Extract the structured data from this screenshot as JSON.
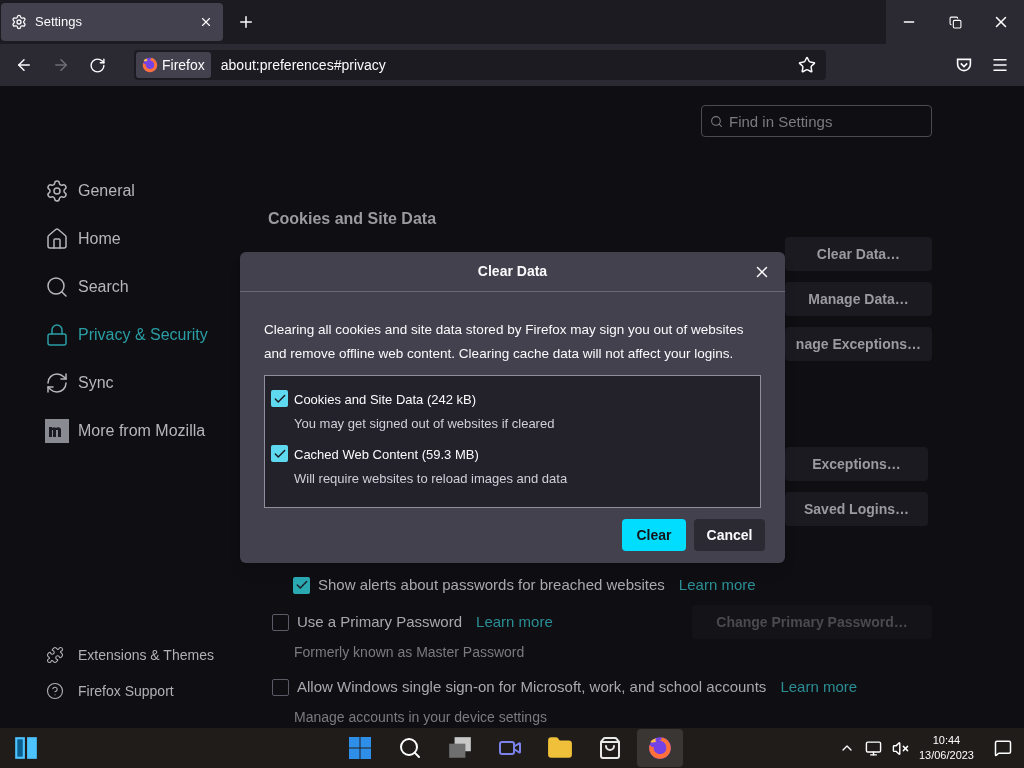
{
  "tab": {
    "title": "Settings",
    "selected": true
  },
  "toolbar": {
    "identity": "Firefox",
    "url": "about:preferences#privacy"
  },
  "search": {
    "placeholder": "Find in Settings"
  },
  "sidebar": {
    "items": [
      {
        "label": "General",
        "selected": false
      },
      {
        "label": "Home",
        "selected": false
      },
      {
        "label": "Search",
        "selected": false
      },
      {
        "label": "Privacy & Security",
        "selected": true
      },
      {
        "label": "Sync",
        "selected": false
      },
      {
        "label": "More from Mozilla",
        "selected": false
      }
    ],
    "footer": [
      "Extensions & Themes",
      "Firefox Support"
    ]
  },
  "cookies": {
    "heading": "Cookies and Site Data",
    "buttons": [
      "Clear Data…",
      "Manage Data…",
      "nage Exceptions…"
    ]
  },
  "logins": {
    "buttons": [
      "Exceptions…",
      "Saved Logins…"
    ],
    "options": [
      {
        "kind": "suboption",
        "label": "Show alerts about passwords for breached websites",
        "checked": true,
        "link": "Learn more"
      },
      {
        "kind": "option",
        "label": "Use a Primary Password",
        "checked": false,
        "link": "Learn more",
        "button": {
          "label": "Change Primary Password…",
          "disabled": true
        },
        "note": "Formerly known as Master Password"
      },
      {
        "kind": "option",
        "label": "Allow Windows single sign-on for Microsoft, work, and school accounts",
        "checked": false,
        "link": "Learn more",
        "note": "Manage accounts in your device settings"
      }
    ]
  },
  "dialog": {
    "title": "Clear Data",
    "message": "Clearing all cookies and site data stored by Firefox may sign you out of websites and remove offline web content. Clearing cache data will not affect your logins.",
    "options": [
      {
        "label": "Cookies and Site Data (242 kB)",
        "hint": "You may get signed out of websites if cleared",
        "checked": true
      },
      {
        "label": "Cached Web Content (59.3 MB)",
        "hint": "Will require websites to reload images and data",
        "checked": true
      }
    ],
    "buttons": [
      {
        "label": "Clear",
        "kind": "primary"
      },
      {
        "label": "Cancel",
        "kind": "secondary"
      }
    ]
  },
  "taskbar": {
    "apps": [
      {
        "selected": false
      },
      {
        "selected": false
      },
      {
        "selected": false
      },
      {
        "selected": false
      },
      {
        "selected": false
      },
      {
        "selected": false
      },
      {
        "selected": true
      }
    ],
    "time": "10:44",
    "date": "13/06/2023"
  }
}
